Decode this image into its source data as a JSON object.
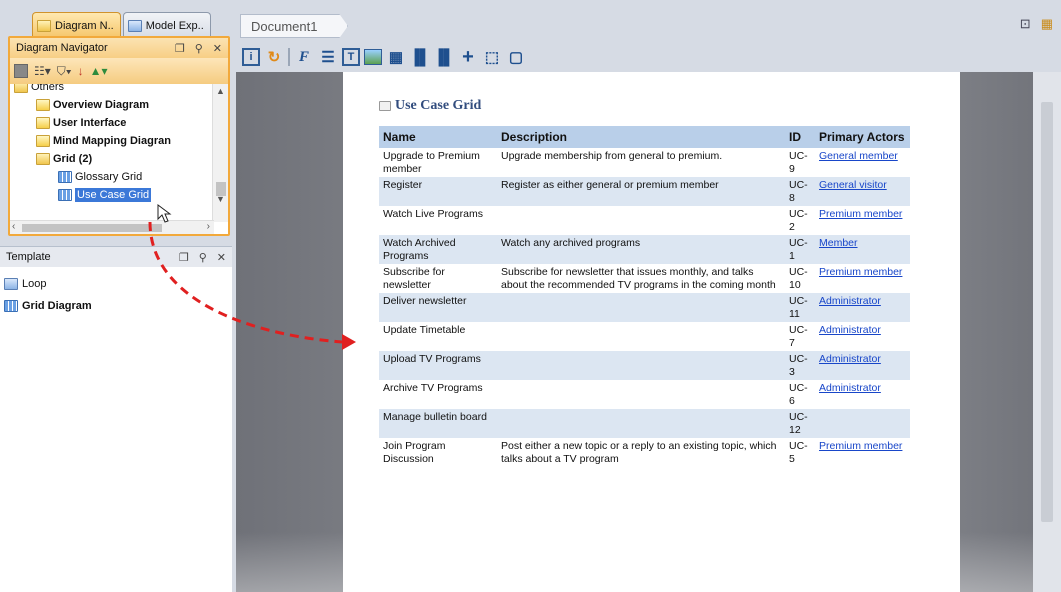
{
  "left": {
    "top_tabs": [
      "Diagram N..",
      "Model Exp.."
    ],
    "navigator": {
      "title": "Diagram Navigator",
      "tree": [
        {
          "label": "Others",
          "bold": false,
          "indent": 0
        },
        {
          "label": "Overview Diagram",
          "bold": true,
          "indent": 1
        },
        {
          "label": "User Interface",
          "bold": true,
          "indent": 1
        },
        {
          "label": "Mind Mapping Diagran",
          "bold": true,
          "indent": 1
        },
        {
          "label": "Grid (2)",
          "bold": true,
          "indent": 1
        },
        {
          "label": "Glossary Grid",
          "bold": false,
          "indent": 2
        },
        {
          "label": "Use Case Grid",
          "bold": false,
          "indent": 2,
          "selected": true
        }
      ]
    },
    "template": {
      "title": "Template",
      "items": [
        {
          "label": "Loop",
          "bold": false
        },
        {
          "label": "Grid Diagram",
          "bold": true
        }
      ]
    }
  },
  "editor": {
    "doc_tab": "Document1",
    "toolbar": [
      "i",
      "F",
      "T",
      "+"
    ],
    "page_title": "Use Case Grid",
    "columns": [
      "Name",
      "Description",
      "ID",
      "Primary Actors"
    ],
    "rows": [
      {
        "name": "Upgrade to Premium member",
        "desc": "Upgrade membership from general to premium.",
        "id": "UC-9",
        "actor": "General member"
      },
      {
        "name": "Register",
        "desc": "Register as either general or premium member",
        "id": "UC-8",
        "actor": "General visitor"
      },
      {
        "name": "Watch Live Programs",
        "desc": "",
        "id": "UC-2",
        "actor": "Premium member"
      },
      {
        "name": "Watch Archived Programs",
        "desc": "Watch any archived programs",
        "id": "UC-1",
        "actor": "Member"
      },
      {
        "name": "Subscribe for newsletter",
        "desc": "Subscribe for newsletter that issues monthly, and talks about the recommended TV programs in the coming month",
        "id": "UC-10",
        "actor": "Premium member"
      },
      {
        "name": "Deliver newsletter",
        "desc": "",
        "id": "UC-11",
        "actor": "Administrator"
      },
      {
        "name": "Update Timetable",
        "desc": "",
        "id": "UC-7",
        "actor": "Administrator"
      },
      {
        "name": "Upload TV Programs",
        "desc": "",
        "id": "UC-3",
        "actor": "Administrator"
      },
      {
        "name": "Archive TV Programs",
        "desc": "",
        "id": "UC-6",
        "actor": "Administrator"
      },
      {
        "name": "Manage bulletin board",
        "desc": "",
        "id": "UC-12",
        "actor": ""
      },
      {
        "name": "Join Program Discussion",
        "desc": "Post either a new topic or a reply to an existing topic, which talks about a TV program",
        "id": "UC-5",
        "actor": "Premium member"
      }
    ]
  },
  "colors": {
    "accent_orange": "#f2a93b",
    "header_blue": "#b9cfe9",
    "row_alt": "#dce6f2",
    "link": "#1846c9",
    "arrow_red": "#e02020"
  }
}
